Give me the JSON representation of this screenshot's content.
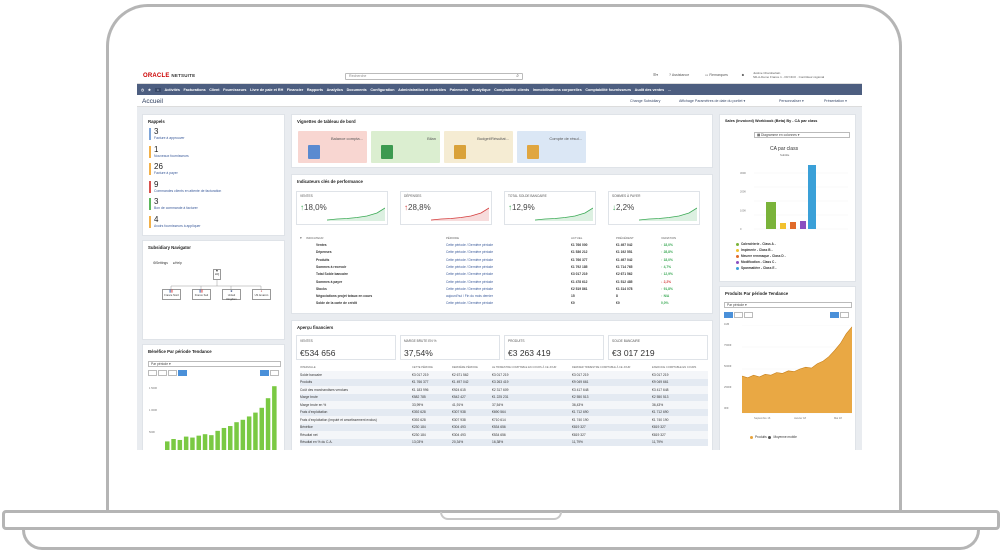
{
  "topbar": {
    "logo_oracle": "ORACLE",
    "logo_netsuite": "NETSUITE",
    "search_placeholder": "Recherche",
    "link1": "Assistance",
    "link2": "Remarques",
    "user_name": "Justine Chamberlain",
    "user_role": "SD-A-Demo France 1 - FR NCO · Contrôleur régional"
  },
  "nav": {
    "items": [
      "Activités",
      "Facturations",
      "Client",
      "Fournisseurs",
      "Livre de paie et RH",
      "Financier",
      "Rapports",
      "Analytics",
      "Documents",
      "Configuration",
      "Administration et contrôles",
      "Paiements",
      "Analytique",
      "Comptabilité clients",
      "Immobilisations corporelles",
      "Comptabilité fournisseurs",
      "Audit des ventes"
    ],
    "more": "..."
  },
  "subheader": {
    "title": "Accueil",
    "links": [
      "Change Subsidiary",
      "Affichage Paramètres de date du portlet",
      "Personnaliser",
      "Présentation"
    ]
  },
  "reminders": {
    "title": "Rappels",
    "items": [
      {
        "count": "3",
        "label": "Facture à approuver",
        "color": "#7fa6d9"
      },
      {
        "count": "1",
        "label": "Nouveaux fournisseurs",
        "color": "#f2b14a"
      },
      {
        "count": "26",
        "label": "Facture à payer",
        "color": "#f2b14a"
      },
      {
        "count": "9",
        "label": "Commandes clients en attente de facturation",
        "color": "#d9534f"
      },
      {
        "count": "3",
        "label": "Bon de commande à facturer",
        "color": "#5cb85c"
      },
      {
        "count": "4",
        "label": "Avoirs fournisseurs à appliquer",
        "color": "#f2b14a"
      }
    ]
  },
  "subsidiary": {
    "title": "Subsidiary Navigator",
    "top1": "Settings",
    "top2": "Help",
    "root": "HQ",
    "nodes": [
      "France Nord",
      "France Sud",
      "United Kingdom",
      "US Amazon"
    ]
  },
  "benefice": {
    "title": "Bénéfice Par période Tendance",
    "select": "Par période",
    "yticks": [
      "1 500€",
      "1 000€",
      "500€"
    ]
  },
  "vignettes": {
    "title": "Vignettes de tableau de bord",
    "tiles": [
      {
        "label": "Balance compta...",
        "bg": "#f8d6d1",
        "icon": "#5a8ad0"
      },
      {
        "label": "Bilan",
        "bg": "#dbeed0",
        "icon": "#3c9a50"
      },
      {
        "label": "Budget/Résultat...",
        "bg": "#f5ecd3",
        "icon": "#d9a23a"
      },
      {
        "label": "Compte de résul...",
        "bg": "#dbe7f5",
        "icon": "#e0a640"
      }
    ]
  },
  "kpis": {
    "title": "Indicateurs clés de performance",
    "cards": [
      {
        "label": "VENTES",
        "value": "18,0%",
        "arrow": "↑",
        "color": "#3caa56"
      },
      {
        "label": "DÉPENSES",
        "value": "28,8%",
        "arrow": "↑",
        "color": "#d43d3d"
      },
      {
        "label": "TOTAL SOLDE BANCAIRE",
        "value": "12,9%",
        "arrow": "↑",
        "color": "#3caa56"
      },
      {
        "label": "SOMMES À PAYER",
        "value": "2,2%",
        "arrow": "↓",
        "color": "#3caa56"
      }
    ],
    "headers": [
      "INDICATEUR",
      "PÉRIODE",
      "ACTUEL",
      "PRÉCÉDENT",
      "VARIATION"
    ],
    "rows": [
      [
        "Ventes",
        "Cette période / Dernière période",
        "€1 766 000",
        "€1 497 042",
        "↑ 18,0%"
      ],
      [
        "Dépenses",
        "Cette période / Dernière période",
        "€1 536 212",
        "€1 192 551",
        "↑ 28,8%"
      ],
      [
        "Produits",
        "Cette période / Dernière période",
        "€1 766 377",
        "€1 497 042",
        "↑ 18,0%"
      ],
      [
        "Sommes à recevoir",
        "Cette période / Dernière période",
        "€1 792 185",
        "€1 714 765",
        "↑ 4,7%"
      ],
      [
        "Total Solde bancaire",
        "Cette période / Dernière période",
        "€3 017 219",
        "€2 671 562",
        "↑ 12,9%"
      ],
      [
        "Sommes à payer",
        "Cette période / Dernière période",
        "€1 478 612",
        "€1 512 485",
        "↓ 2,2%"
      ],
      [
        "Stocks",
        "Cette période / Dernière période",
        "€2 519 861",
        "€1 314 078",
        "↑ 91,8%"
      ],
      [
        "Négociations projet totaux en cours",
        "aujourd'hui / Fin du mois dernier",
        "15",
        "8",
        "↑ N/A"
      ],
      [
        "Solde de la carte de crédit",
        "Cette période / Dernière période",
        "€0",
        "€0",
        "0,0%"
      ]
    ]
  },
  "apercu": {
    "title": "Aperçu financiers",
    "boxes": [
      {
        "label": "VENTES",
        "value": "€534 656"
      },
      {
        "label": "MARGE BRUTE EN %",
        "value": "37,54%"
      },
      {
        "label": "PRODUITS",
        "value": "€3 263 419"
      },
      {
        "label": "SOLDE BANCAIRE",
        "value": "€3 017 219"
      }
    ],
    "headers": [
      "INTERVALLE",
      "CETTE PÉRIODE",
      "DERNIÈRE PÉRIODE",
      "LE TRIMESTRE COMPTABLE EN COURS À CE JOUR",
      "DERNIER TRIMESTRE COMPTABLE À CE JOUR",
      "EXERCICE COMPTABLE EN COURS"
    ],
    "rows": [
      [
        "Solde bancaire",
        "€3 017 219",
        "€2 671 562",
        "€3 017 219",
        "€3 017 219",
        "€3 017 219"
      ],
      [
        "Produits",
        "€1 766 377",
        "€1 497 042",
        "€3 263 419",
        "€9 049 661",
        "€9 049 661"
      ],
      [
        "Coût des marchandises vendues",
        "€1 183 996",
        "€924 615",
        "€2 317 609",
        "€3 417 648",
        "€3 417 648"
      ],
      [
        "Marge brute",
        "€582 785",
        "€542 427",
        "€1 225 231",
        "€2 550 513",
        "€2 550 513"
      ],
      [
        "Marge brute en %",
        "33,99%",
        "41,91%",
        "37,54%",
        "36,43%",
        "36,43%"
      ],
      [
        "Frais d'exploitation",
        "€392 628",
        "€307 938",
        "€690 564",
        "€1 712 690",
        "€1 712 690"
      ],
      [
        "Frais d'exploitation (imputé et amortissement exclus)",
        "€392 628",
        "€307 938",
        "€710 614",
        "€1 740 190",
        "€1 740 190"
      ],
      [
        "Bénéfice",
        "€230 184",
        "€304 493",
        "€534 656",
        "€819 327",
        "€819 327"
      ],
      [
        "Résultat net",
        "€230 184",
        "€304 493",
        "€534 656",
        "€819 327",
        "€819 327"
      ],
      [
        "Résultat en % du C.A.",
        "13,03%",
        "20,34%",
        "16,38%",
        "11,79%",
        "11,79%"
      ]
    ]
  },
  "sales_chart": {
    "title": "Sales (Invoiced) Workbook (Beta) By - CA par class",
    "selector": "Diagramme en colonnes",
    "chart_title": "CA par class",
    "subtitle": "Subtitle",
    "legend": [
      {
        "label": "Calendrierie - Class A -",
        "color": "#7ab33a"
      },
      {
        "label": "Impimerie - Class B -",
        "color": "#f2c12e"
      },
      {
        "label": "Meuere remmaque - Class D -",
        "color": "#e06a2a"
      },
      {
        "label": "Modification - Class C -",
        "color": "#8a4fc0"
      },
      {
        "label": "Spanmatière - Class E -",
        "color": "#3aa0d8"
      }
    ]
  },
  "produits_chart": {
    "title": "Produits Par période Tendance",
    "select": "Par période",
    "yticks": [
      "1M€",
      "750K€",
      "500K€",
      "250K€",
      "0K€"
    ],
    "xticks": [
      "Septembre 16",
      "Janvier 18",
      "Mai 18"
    ],
    "legend": [
      "Produits",
      "Moyenne mobile"
    ]
  },
  "chart_data": [
    {
      "type": "bar",
      "title": "CA par class",
      "subtitle": "Subtitle",
      "categories": [
        "Calendrierie - Class A -",
        "Impimerie - Class B -",
        "Meuere remmaque - Class D -",
        "Modification - Class C -",
        "Spanmatière - Class E -"
      ],
      "values": [
        135000,
        30000,
        35000,
        40000,
        320000
      ],
      "colors": [
        "#7ab33a",
        "#f2c12e",
        "#e06a2a",
        "#8a4fc0",
        "#3aa0d8"
      ]
    },
    {
      "type": "area",
      "title": "Produits Par période Tendance",
      "series": [
        {
          "name": "Produits",
          "values": [
            420,
            400,
            430,
            410,
            440,
            430,
            460,
            450,
            480,
            470,
            500,
            520,
            510,
            560,
            590,
            640,
            710,
            790,
            900,
            980
          ]
        }
      ],
      "ylim": [
        0,
        1000
      ]
    },
    {
      "type": "bar",
      "title": "Bénéfice Par période Tendance",
      "values": [
        200,
        250,
        230,
        300,
        280,
        320,
        350,
        330,
        420,
        480,
        520,
        600,
        650,
        720,
        800,
        900,
        1100,
        1350
      ],
      "ylim": [
        0,
        1500
      ]
    }
  ]
}
